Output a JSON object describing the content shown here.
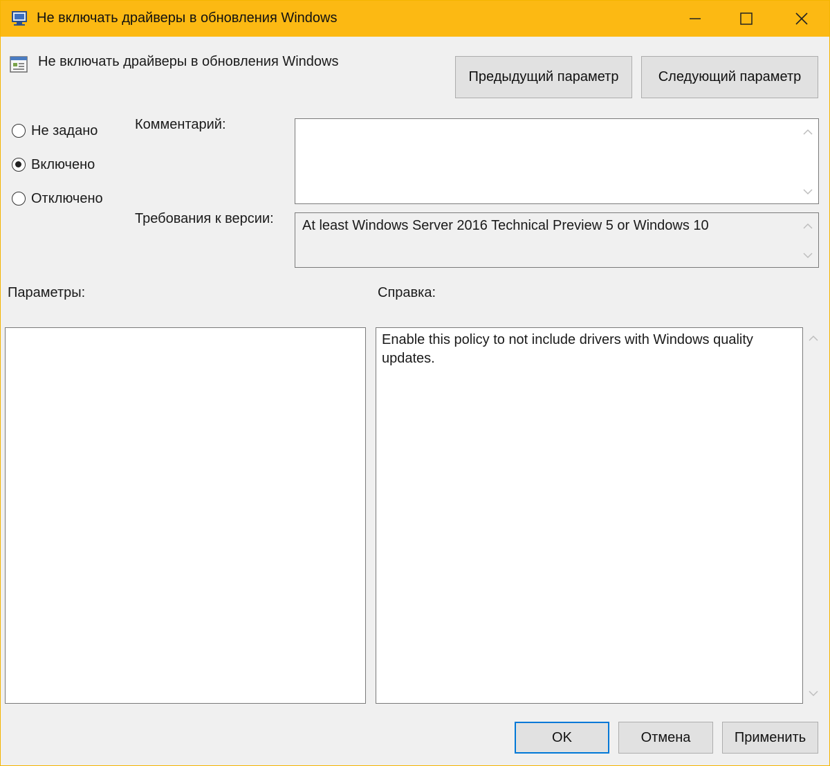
{
  "window": {
    "title": "Не включать драйверы в обновления Windows",
    "accent_color": "#fcb913"
  },
  "header": {
    "policy_name": "Не включать драйверы в обновления Windows",
    "prev_button": "Предыдущий параметр",
    "next_button": "Следующий параметр"
  },
  "state": {
    "options": [
      {
        "label": "Не задано",
        "checked": false
      },
      {
        "label": "Включено",
        "checked": true
      },
      {
        "label": "Отключено",
        "checked": false
      }
    ]
  },
  "comment": {
    "label": "Комментарий:",
    "value": ""
  },
  "version": {
    "label": "Требования к версии:",
    "value": "At least Windows Server 2016 Technical Preview 5 or Windows 10"
  },
  "params": {
    "label": "Параметры:"
  },
  "help": {
    "label": "Справка:",
    "text": "Enable this policy to not include drivers with Windows quality updates."
  },
  "footer": {
    "ok": "OK",
    "cancel": "Отмена",
    "apply": "Применить"
  }
}
